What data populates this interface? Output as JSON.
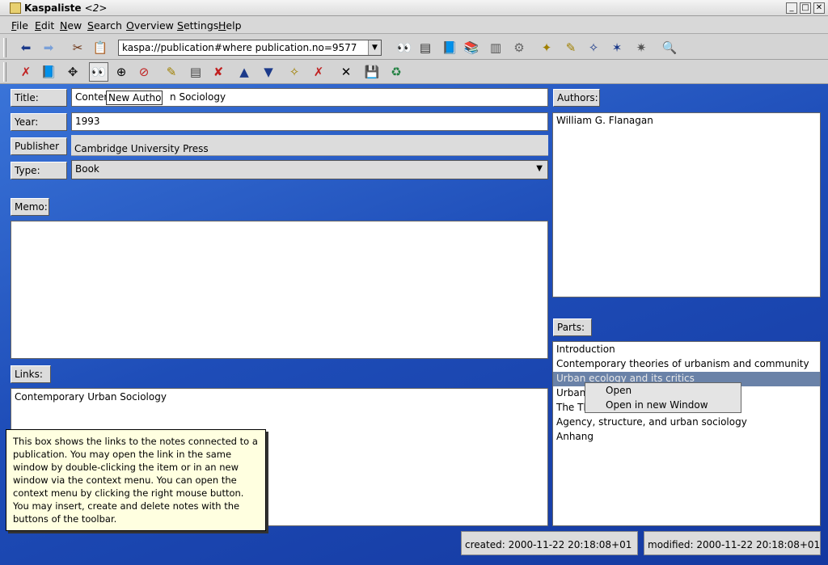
{
  "window": {
    "title": "Kaspaliste",
    "title_suffix": "<2>",
    "buttons": [
      "_",
      "□",
      "✕"
    ]
  },
  "menubar": [
    {
      "label": "File",
      "key": "F",
      "rest": "ile"
    },
    {
      "label": "Edit",
      "key": "E",
      "rest": "dit"
    },
    {
      "label": "New",
      "key": "N",
      "rest": "ew"
    },
    {
      "label": "Search",
      "key": "S",
      "rest": "earch"
    },
    {
      "label": "Overview",
      "key": "O",
      "rest": "verview"
    },
    {
      "label": "Settings",
      "key": "S",
      "rest": "ettings"
    },
    {
      "label": "Help",
      "key": "H",
      "rest": "elp"
    }
  ],
  "toolbar1": {
    "url": "kaspa://publication#where publication.no=9577",
    "icons": [
      "back-arrow-icon",
      "forward-arrow-icon",
      "cut-icon",
      "paste-icon",
      "view-persons-icon",
      "view-notes-icon",
      "view-publications-icon",
      "view-authors-publications-icon",
      "view-journals-icon",
      "view-settings-icon",
      "new-person-icon",
      "new-note-icon",
      "new-publication-icon",
      "new-author-publication-icon",
      "new-journal-icon",
      "search-icon"
    ]
  },
  "toolbar2": {
    "icons": [
      "remove-publication-icon",
      "add-publication-icon",
      "link-icon",
      "new-author-icon",
      "insert-author-icon",
      "delete-author-icon",
      "new-part-icon",
      "insert-part-icon",
      "delete-part-icon",
      "up-author-icon",
      "down-author-icon",
      "new-link-icon",
      "delete-link-icon",
      "delete-icon",
      "save-icon",
      "reload-icon"
    ]
  },
  "form": {
    "title_label": "Title:",
    "title_value": "Contemporary Urban Sociology",
    "title_visible": "Conten",
    "title_after_tooltip": "n Sociology",
    "year_label": "Year:",
    "year_value": "1993",
    "publisher_label": "Publisher",
    "publisher_value": "Cambridge University Press",
    "type_label": "Type:",
    "type_value": "Book",
    "memo_label": "Memo:",
    "links_label": "Links:",
    "links": [
      "Contemporary Urban Sociology"
    ]
  },
  "inline_tooltip": "New Authors",
  "authors": {
    "label": "Authors:",
    "items": [
      "William G. Flanagan"
    ]
  },
  "parts": {
    "label": "Parts:",
    "items": [
      "Introduction",
      "Contemporary theories of urbanism and community",
      "Urban ecology and its critics",
      "Urban",
      "The Th",
      "Agency, structure, and urban sociology",
      "Anhang"
    ],
    "selected_index": 2
  },
  "context_menu": [
    "Open",
    "Open in new Window"
  ],
  "help_tooltip": "This box shows the links to the notes connected to a publication. You may open the link in the same window by double-clicking the item or in an new window via the context menu. You can open the context menu by clicking the right mouse button. You may insert, create and delete notes with the buttons of the toolbar.",
  "status": {
    "created": "created: 2000-11-22 20:18:08+01",
    "modified": "modified: 2000-11-22 20:18:08+01"
  },
  "colors": {
    "content_bg": "#1e4db8",
    "selection": "#6a82a8",
    "tooltip_bg": "#ffffe0"
  }
}
